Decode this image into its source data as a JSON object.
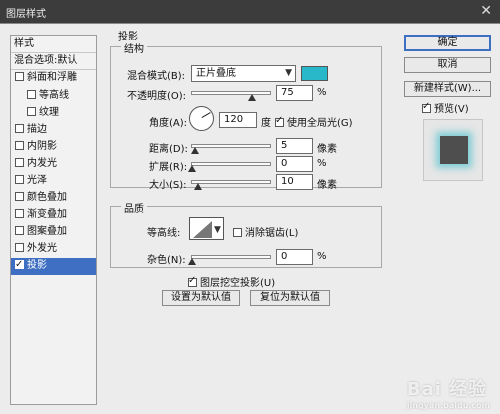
{
  "window": {
    "title": "图层样式",
    "close_glyph": "✕"
  },
  "styles_list": {
    "header": "样式",
    "blend_options": "混合选项:默认",
    "items": [
      {
        "label": "斜面和浮雕",
        "checked": false,
        "indent": false
      },
      {
        "label": "等高线",
        "checked": false,
        "indent": true
      },
      {
        "label": "纹理",
        "checked": false,
        "indent": true
      },
      {
        "label": "描边",
        "checked": false,
        "indent": false
      },
      {
        "label": "内阴影",
        "checked": false,
        "indent": false
      },
      {
        "label": "内发光",
        "checked": false,
        "indent": false
      },
      {
        "label": "光泽",
        "checked": false,
        "indent": false
      },
      {
        "label": "颜色叠加",
        "checked": false,
        "indent": false
      },
      {
        "label": "渐变叠加",
        "checked": false,
        "indent": false
      },
      {
        "label": "图案叠加",
        "checked": false,
        "indent": false
      },
      {
        "label": "外发光",
        "checked": false,
        "indent": false
      },
      {
        "label": "投影",
        "checked": true,
        "indent": false,
        "selected": true
      }
    ]
  },
  "drop_shadow": {
    "section_title": "投影",
    "structure": {
      "title": "结构",
      "blend_mode_label": "混合模式(B):",
      "blend_mode_value": "正片叠底",
      "shadow_color": "#29b8c9",
      "opacity_label": "不透明度(O):",
      "opacity_value": "75",
      "opacity_unit": "%",
      "opacity_level": 0.75,
      "angle_label": "角度(A):",
      "angle_value": "120",
      "angle_unit": "度",
      "global_light_label": "使用全局光(G)",
      "global_light_checked": true,
      "distance_label": "距离(D):",
      "distance_value": "5",
      "distance_unit": "像素",
      "spread_label": "扩展(R):",
      "spread_value": "0",
      "spread_unit": "%",
      "size_label": "大小(S):",
      "size_value": "10",
      "size_unit": "像素"
    },
    "quality": {
      "title": "品质",
      "contour_label": "等高线:",
      "anti_alias_label": "消除锯齿(L)",
      "anti_alias_checked": false,
      "noise_label": "杂色(N):",
      "noise_value": "0",
      "noise_unit": "%"
    },
    "knockout_label": "图层挖空投影(U)",
    "knockout_checked": true,
    "make_default_label": "设置为默认值",
    "reset_default_label": "复位为默认值"
  },
  "buttons": {
    "ok": "确定",
    "cancel": "取消",
    "new_style": "新建样式(W)...",
    "preview_label": "预览(V)",
    "preview_checked": true
  },
  "watermark": {
    "text": "Bai 经验",
    "sub": "jingyan.baidu.com"
  }
}
